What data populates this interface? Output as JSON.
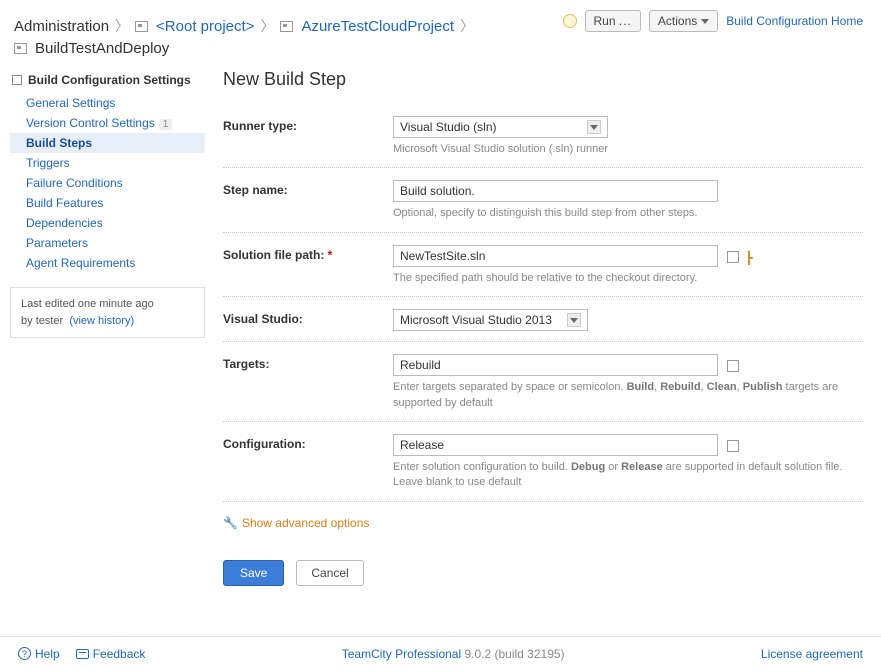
{
  "breadcrumb": {
    "admin": "Administration",
    "root": "<Root project>",
    "project": "AzureTestCloudProject",
    "config": "BuildTestAndDeploy"
  },
  "top": {
    "run": "Run",
    "dots": "...",
    "actions": "Actions",
    "home": "Build Configuration Home"
  },
  "sidebar": {
    "heading": "Build Configuration Settings",
    "items": [
      {
        "label": "General Settings"
      },
      {
        "label": "Version Control Settings",
        "badge": "1"
      },
      {
        "label": "Build Steps",
        "active": true
      },
      {
        "label": "Triggers"
      },
      {
        "label": "Failure Conditions"
      },
      {
        "label": "Build Features"
      },
      {
        "label": "Dependencies"
      },
      {
        "label": "Parameters"
      },
      {
        "label": "Agent Requirements"
      }
    ],
    "edited": {
      "prefix": "Last edited ",
      "when": "one minute ago",
      "by_prefix": "by ",
      "by": "tester",
      "history": "(view history)"
    }
  },
  "page": {
    "title": "New Build Step",
    "runner_type": {
      "label": "Runner type:",
      "value": "Visual Studio (sln)",
      "hint": "Microsoft Visual Studio solution (.sln) runner"
    },
    "step_name": {
      "label": "Step name:",
      "value": "Build solution.",
      "hint": "Optional, specify to distinguish this build step from other steps."
    },
    "solution_path": {
      "label": "Solution file path:",
      "required": "*",
      "value": "NewTestSite.sln",
      "hint": "The specified path should be relative to the checkout directory."
    },
    "visual_studio": {
      "label": "Visual Studio:",
      "value": "Microsoft Visual Studio 2013"
    },
    "targets": {
      "label": "Targets:",
      "value": "Rebuild",
      "hint_pre": "Enter targets separated by space or semicolon. ",
      "hint_b1": "Build",
      "hint_b2": "Rebuild",
      "hint_b3": "Clean",
      "hint_b4": "Publish",
      "hint_post": " targets are supported by default"
    },
    "configuration": {
      "label": "Configuration:",
      "value": "Release",
      "hint_pre": "Enter solution configuration to build. ",
      "hint_b1": "Debug",
      "hint_or": " or ",
      "hint_b2": "Release",
      "hint_post": " are supported in default solution file. Leave blank to use default"
    },
    "advanced": "Show advanced options",
    "save": "Save",
    "cancel": "Cancel"
  },
  "footer": {
    "help": "Help",
    "feedback": "Feedback",
    "product": "TeamCity Professional",
    "version": " 9.0.2 (build 32195)",
    "license": "License agreement"
  }
}
